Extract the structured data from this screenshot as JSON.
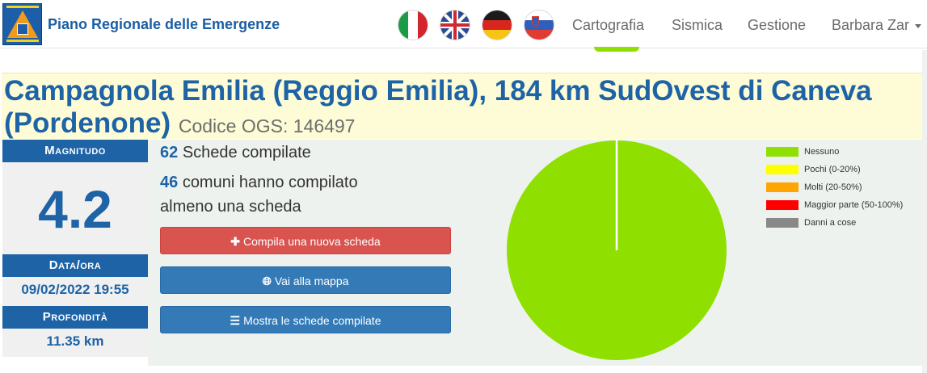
{
  "navbar": {
    "brand": "Piano Regionale delle Emergenze",
    "links": [
      "Cartografia",
      "Sismica",
      "Gestione"
    ],
    "user": "Barbara Zar",
    "flags": [
      "italian-flag",
      "uk-flag",
      "german-flag",
      "slovenian-flag"
    ]
  },
  "event": {
    "title": "Campagnola Emilia (Reggio Emilia), 184 km SudOvest di Caneva (Pordenone)",
    "code": "Codice OGS: 146497"
  },
  "info": {
    "magnitude_label": "Magnitudo",
    "magnitude": "4.2",
    "datetime_label": "Data/ora",
    "datetime": "09/02/2022 19:55",
    "depth_label": "Profondità",
    "depth": "11.35 km"
  },
  "stats": {
    "schede_count": "62",
    "schede_text": "Schede compilate",
    "comuni_count": "46",
    "comuni_text_1": "comuni hanno compilato",
    "comuni_text_2": "almeno una scheda"
  },
  "buttons": {
    "new_form": "Compila una nuova scheda",
    "map": "Vai alla mappa",
    "show_forms": "Mostra le schede compilate"
  },
  "colors": {
    "brand_blue": "#1d63a6",
    "danger_red": "#d9534f",
    "primary_blue": "#337ab7"
  },
  "chart_data": {
    "type": "pie",
    "legend_position": "right",
    "categories": [
      "Nessuno",
      "Pochi (0-20%)",
      "Molti (20-50%)",
      "Maggior parte (50-100%)",
      "Danni a cose"
    ],
    "colors": [
      "#8fe000",
      "#ffff00",
      "#ffa500",
      "#ff0000",
      "#888888"
    ],
    "values": [
      100,
      0,
      0,
      0,
      0
    ]
  }
}
